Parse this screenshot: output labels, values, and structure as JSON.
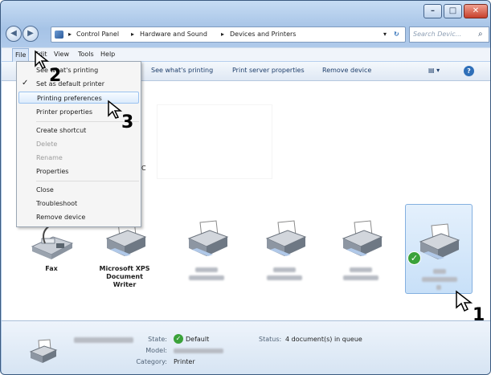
{
  "window": {
    "minimize": "–",
    "maximize": "□",
    "close": "✕"
  },
  "address": {
    "crumbs": [
      "Control Panel",
      "Hardware and Sound",
      "Devices and Printers"
    ]
  },
  "search": {
    "placeholder": "Search Devic..."
  },
  "menubar": [
    {
      "label": "File"
    },
    {
      "label": "Edit"
    },
    {
      "label": "View"
    },
    {
      "label": "Tools"
    },
    {
      "label": "Help"
    }
  ],
  "toolbar": {
    "see_printing": "See what's printing",
    "print_server": "Print server properties",
    "remove_device": "Remove device"
  },
  "file_menu": {
    "see_printing": "See what's printing",
    "set_default": "Set as default printer",
    "printing_preferences": "Printing preferences",
    "printer_properties": "Printer properties",
    "create_shortcut": "Create shortcut",
    "delete": "Delete",
    "rename": "Rename",
    "properties": "Properties",
    "close": "Close",
    "troubleshoot": "Troubleshoot",
    "remove_device": "Remove device"
  },
  "devices": [
    {
      "name": "Fax"
    },
    {
      "name": "Microsoft XPS Document Writer"
    },
    {
      "name": ""
    },
    {
      "name": ""
    },
    {
      "name": ""
    },
    {
      "name": ""
    }
  ],
  "content_partial_text": "C",
  "details": {
    "state_label": "State:",
    "state_value": "Default",
    "model_label": "Model:",
    "category_label": "Category:",
    "category_value": "Printer",
    "status_label": "Status:",
    "status_value": "4 document(s) in queue"
  },
  "callouts": {
    "one": "1",
    "two": "2",
    "three": "3"
  }
}
